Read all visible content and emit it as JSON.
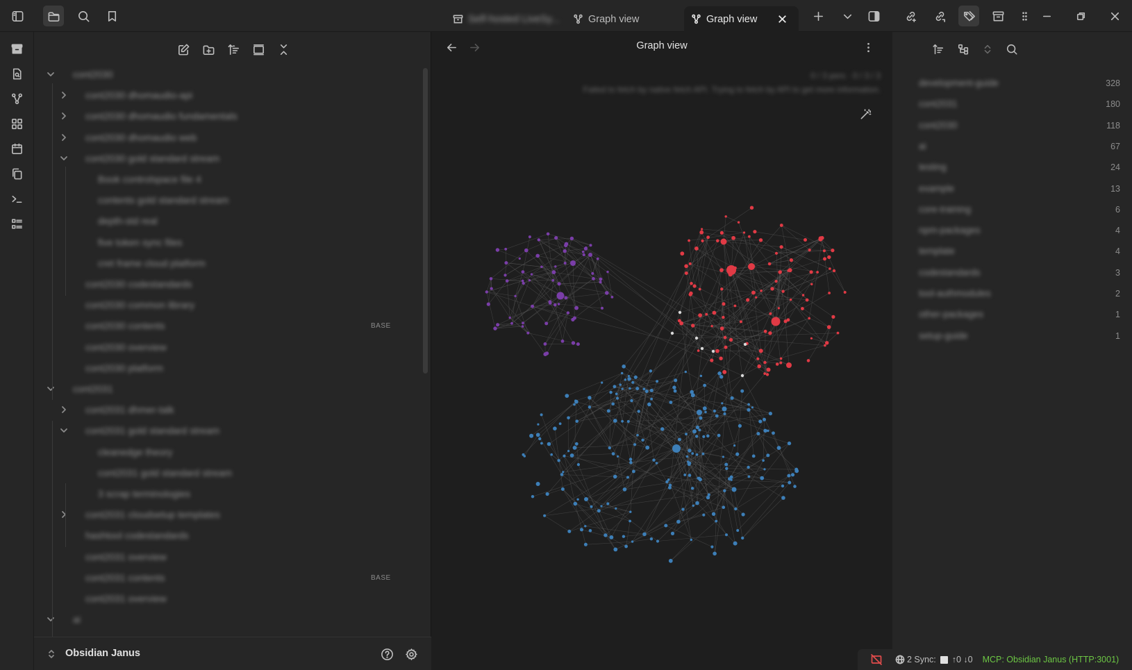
{
  "titlebar": {
    "tabs": [
      {
        "label": "Self-hosted LiveSy...",
        "icon": "archive-icon",
        "blurred": true
      },
      {
        "label": "Graph view",
        "icon": "graph-icon"
      },
      {
        "label": "Graph view",
        "icon": "graph-icon",
        "active": true
      }
    ]
  },
  "graph_view": {
    "title": "Graph view",
    "notice_line1": "0 / 3 pers · 0 / 3 / 3",
    "notice_line2": "Failed to fetch by native fetch API. Trying to fetch by API to get more information."
  },
  "file_tree": {
    "items": [
      {
        "label": "cont2030",
        "level": 0,
        "state": "open"
      },
      {
        "label": "cont2030 dhomaudio-api",
        "level": 1,
        "state": "closed"
      },
      {
        "label": "cont2030 dhomaudio fundamentals",
        "level": 1,
        "state": "closed"
      },
      {
        "label": "cont2030 dhomaudio web",
        "level": 1,
        "state": "closed"
      },
      {
        "label": "cont2030 gold standard stream",
        "level": 1,
        "state": "open"
      },
      {
        "label": "Book controlspace file 4",
        "level": 2
      },
      {
        "label": "contents gold standard stream",
        "level": 2
      },
      {
        "label": "depth-std real",
        "level": 2
      },
      {
        "label": "five token sync files",
        "level": 2
      },
      {
        "label": "cret frame cloud platform",
        "level": 2
      },
      {
        "label": "cont2030 codestandards",
        "level": 1
      },
      {
        "label": "cont2030 common library",
        "level": 1
      },
      {
        "label": "cont2030 contents",
        "level": 1,
        "badge": "BASE"
      },
      {
        "label": "cont2030 overview",
        "level": 1
      },
      {
        "label": "cont2030 platform",
        "level": 1
      },
      {
        "label": "cont2031",
        "level": 0,
        "state": "open"
      },
      {
        "label": "cont2031 dhmer-talk",
        "level": 1,
        "state": "closed"
      },
      {
        "label": "cont2031 gold standard stream",
        "level": 1,
        "state": "open"
      },
      {
        "label": "cleanedge theory",
        "level": 2
      },
      {
        "label": "cont2031 gold standard stream",
        "level": 2
      },
      {
        "label": "3 scrap terminologies",
        "level": 2
      },
      {
        "label": "cont2031 cloudsetup templates",
        "level": 1,
        "state": "closed"
      },
      {
        "label": "hashtool codestandards",
        "level": 1
      },
      {
        "label": "cont2031 overview",
        "level": 1
      },
      {
        "label": "cont2031 contents",
        "level": 1,
        "badge": "BASE"
      },
      {
        "label": "cont2031 overview",
        "level": 1
      },
      {
        "label": "ai",
        "level": 0,
        "state": "open"
      }
    ],
    "vault_name": "Obsidian Janus"
  },
  "tags": [
    {
      "name": "development-guide",
      "count": "328"
    },
    {
      "name": "cont2031",
      "count": "180"
    },
    {
      "name": "cont2030",
      "count": "118"
    },
    {
      "name": "ai",
      "count": "67"
    },
    {
      "name": "testing",
      "count": "24"
    },
    {
      "name": "example",
      "count": "13"
    },
    {
      "name": "core-training",
      "count": "6"
    },
    {
      "name": "npm-packages",
      "count": "4"
    },
    {
      "name": "template",
      "count": "4"
    },
    {
      "name": "codestandards",
      "count": "3"
    },
    {
      "name": "tool-authmodules",
      "count": "2"
    },
    {
      "name": "other-packages",
      "count": "1"
    },
    {
      "name": "setup-guide",
      "count": "1"
    }
  ],
  "status_bar": {
    "sync_label": "2 Sync:",
    "sync_counts": "↑0 ↓0",
    "mcp_label": "MCP: Obsidian Janus (HTTP:3001)"
  },
  "colors": {
    "accent_red": "#e13a45",
    "accent_purple": "#7a3ea8",
    "accent_blue": "#3d7fb8",
    "mcp_green": "#6cc644"
  }
}
